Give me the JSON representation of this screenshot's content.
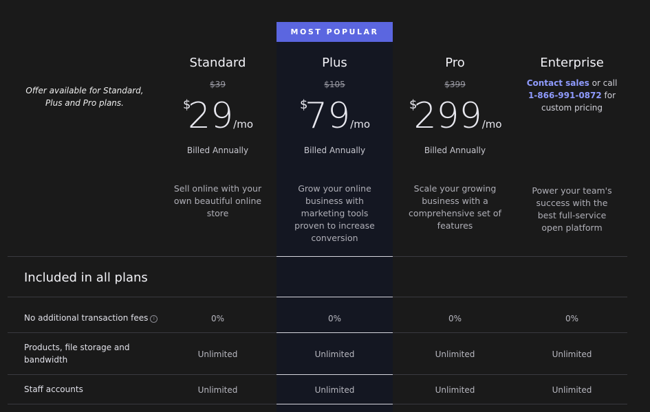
{
  "badge": "MOST POPULAR",
  "offer_note": "Offer available for Standard, Plus and Pro plans.",
  "plans": [
    {
      "name": "Standard",
      "old_price": "$39",
      "currency": "$",
      "amount": "29",
      "period": "/mo",
      "billing": "Billed Annually",
      "description": "Sell online with your own beautiful online store"
    },
    {
      "name": "Plus",
      "old_price": "$105",
      "currency": "$",
      "amount": "79",
      "period": "/mo",
      "billing": "Billed Annually",
      "description": "Grow your online business with marketing tools proven to increase conversion"
    },
    {
      "name": "Pro",
      "old_price": "$399",
      "currency": "$",
      "amount": "299",
      "period": "/mo",
      "billing": "Billed Annually",
      "description": "Scale your growing business with a comprehensive set of features"
    },
    {
      "name": "Enterprise",
      "contact_link": "Contact sales",
      "contact_text": " or call",
      "phone": "1-866-991-0872",
      "phone_suffix": " for",
      "pricing_text": "custom pricing",
      "description": "Power your team's success with the best full-service open platform"
    }
  ],
  "section_title": "Included in all plans",
  "rows": [
    {
      "label": "No additional transaction fees",
      "values": [
        "0%",
        "0%",
        "0%",
        "0%"
      ]
    },
    {
      "label": "Products, file storage and bandwidth",
      "values": [
        "Unlimited",
        "Unlimited",
        "Unlimited",
        "Unlimited"
      ]
    },
    {
      "label": "Staff accounts",
      "values": [
        "Unlimited",
        "Unlimited",
        "Unlimited",
        "Unlimited"
      ]
    }
  ],
  "colors": {
    "accent": "#5b66e0",
    "link": "#8f9bff",
    "background": "#1a1a1a",
    "highlight_column": "#141722"
  },
  "icons": {
    "info": "info-circle-icon"
  }
}
